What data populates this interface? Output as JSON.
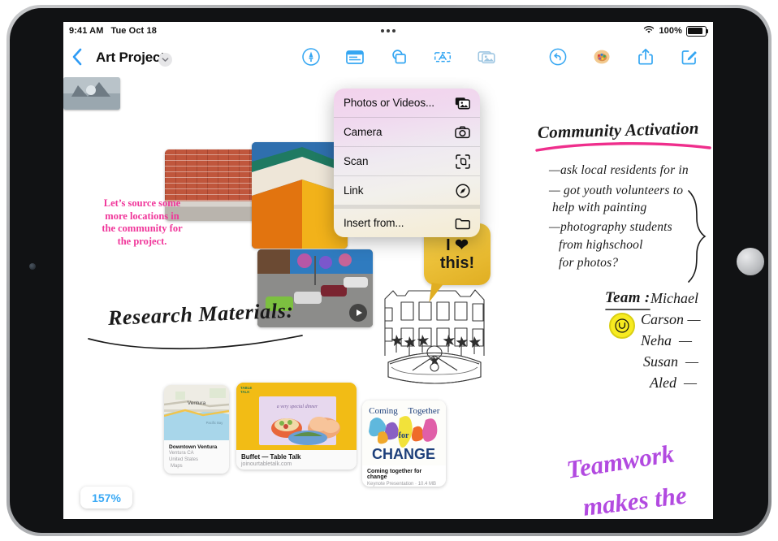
{
  "status_bar": {
    "time": "9:41 AM",
    "date": "Tue Oct 18",
    "battery_percent": "100%",
    "wifi_icon": "wifi-icon",
    "battery_icon": "battery-full-icon"
  },
  "nav": {
    "back_icon": "chevron-left-icon",
    "title": "Art Project",
    "title_chevron_icon": "chevron-down-icon",
    "tools": [
      {
        "name": "markup-pen-tool",
        "icon": "pen-markup-icon",
        "selected": false
      },
      {
        "name": "sticky-note-tool",
        "icon": "sticky-note-icon",
        "selected": false
      },
      {
        "name": "shapes-tool",
        "icon": "shapes-icon",
        "selected": false
      },
      {
        "name": "text-box-tool",
        "icon": "text-box-icon",
        "selected": false
      },
      {
        "name": "media-insert-tool",
        "icon": "photos-stack-icon",
        "selected": true
      }
    ],
    "actions": [
      {
        "name": "undo-button",
        "icon": "undo-icon"
      },
      {
        "name": "color-palette-button",
        "icon": "palette-icon"
      },
      {
        "name": "share-button",
        "icon": "share-icon"
      },
      {
        "name": "compose-button",
        "icon": "compose-icon"
      }
    ]
  },
  "insert_menu": {
    "items": [
      {
        "label": "Photos or Videos...",
        "icon": "photos-stack-icon"
      },
      {
        "label": "Camera",
        "icon": "camera-icon"
      },
      {
        "label": "Scan",
        "icon": "scan-icon"
      },
      {
        "label": "Link",
        "icon": "compass-link-icon"
      },
      {
        "label": "Insert from...",
        "icon": "folder-icon"
      }
    ]
  },
  "canvas": {
    "pink_note": "Let’s source some\nmore locations in\nthe community for\nthe project.",
    "research_heading": "Research Materials:",
    "bubble_line1": "I ❤",
    "bubble_line2": "this!",
    "community": {
      "title": "Community Activation",
      "bullets": [
        "—ask local residents for in",
        "— got youth volunteers to",
        "help with painting",
        "—photography students",
        "from highschool",
        "for photos?"
      ]
    },
    "team": {
      "heading": "Team :",
      "members": [
        "Michael",
        "Carson —",
        "Neha  —",
        "Susan  —",
        "Aled  —"
      ]
    },
    "teamwork_line1": "Teamwork",
    "teamwork_line2": "makes the",
    "cards": {
      "map": {
        "title": "Downtown Ventura",
        "line2": "Ventura CA",
        "line3": "United States",
        "source": "Maps",
        "map_label": "Ventura"
      },
      "link": {
        "title": "Buffet — Table Talk",
        "url": "joinourtabletalk.com",
        "badge": "TABLE TALK"
      },
      "keynote": {
        "word1": "Coming",
        "word2": "Together",
        "word3": "for",
        "word4": "CHANGE",
        "title": "Coming together for change",
        "meta": "Keynote Presentation · 10.4 MB"
      }
    }
  },
  "zoom_control": {
    "level": "157%"
  }
}
